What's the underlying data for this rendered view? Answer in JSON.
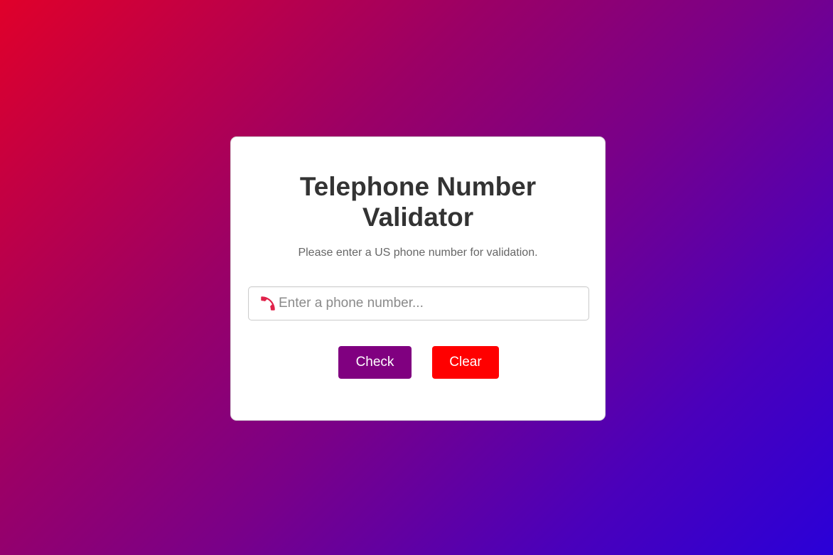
{
  "card": {
    "title": "Telephone Number Validator",
    "subtitle": "Please enter a US phone number for validation."
  },
  "input": {
    "icon": "telephone-receiver-icon",
    "placeholder": "Enter a phone number...",
    "value": ""
  },
  "buttons": {
    "check_label": "Check",
    "clear_label": "Clear"
  },
  "colors": {
    "check_button": "#800080",
    "clear_button": "#ff0000",
    "gradient_start": "#e0002a",
    "gradient_end": "#2a00d8"
  }
}
